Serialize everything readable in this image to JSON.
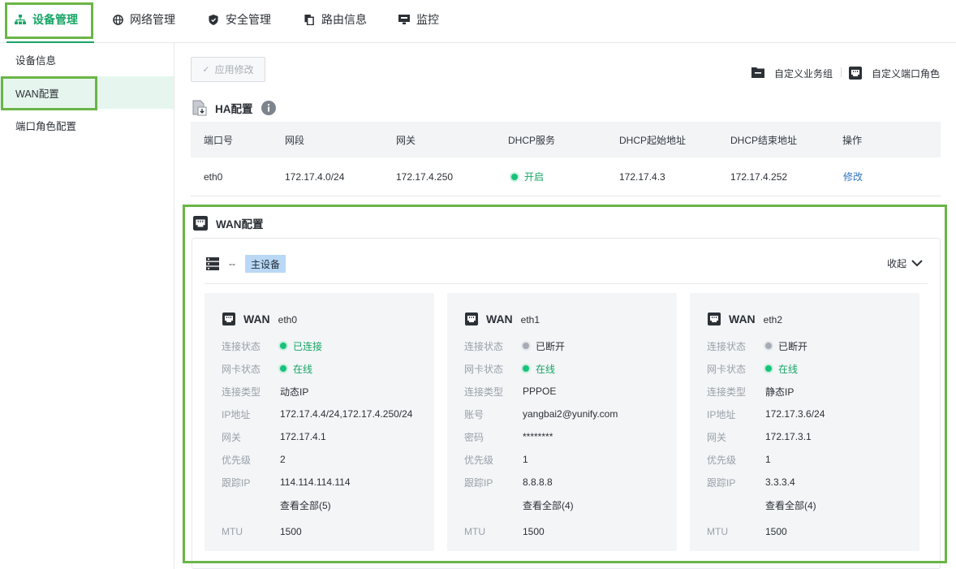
{
  "nav": {
    "tabs": [
      {
        "label": "设备管理",
        "icon": "network-device-icon"
      },
      {
        "label": "网络管理",
        "icon": "globe-icon"
      },
      {
        "label": "安全管理",
        "icon": "shield-icon"
      },
      {
        "label": "路由信息",
        "icon": "route-copy-icon"
      },
      {
        "label": "监控",
        "icon": "monitor-icon"
      }
    ]
  },
  "sidebar": {
    "items": [
      {
        "label": "设备信息"
      },
      {
        "label": "WAN配置"
      },
      {
        "label": "端口角色配置"
      }
    ]
  },
  "toolbar": {
    "apply_label": "应用修改",
    "custom_group_label": "自定义业务组",
    "custom_port_role_label": "自定义端口角色"
  },
  "ha": {
    "title": "HA配置",
    "columns": [
      "端口号",
      "网段",
      "网关",
      "DHCP服务",
      "DHCP起始地址",
      "DHCP结束地址",
      "操作"
    ],
    "row": {
      "port": "eth0",
      "segment": "172.17.4.0/24",
      "gateway": "172.17.4.250",
      "dhcp": "开启",
      "dhcp_start": "172.17.4.3",
      "dhcp_end": "172.17.4.252",
      "action": "修改"
    }
  },
  "wan": {
    "title": "WAN配置",
    "dash": "--",
    "device_badge": "主设备",
    "collapse_label": "收起",
    "cards": [
      {
        "wan": "WAN",
        "eth": "eth0",
        "rows": [
          {
            "k": "连接状态",
            "v": "已连接",
            "status": "green"
          },
          {
            "k": "网卡状态",
            "v": "在线",
            "status": "green"
          },
          {
            "k": "连接类型",
            "v": "动态IP"
          },
          {
            "k": "IP地址",
            "v": "172.17.4.4/24,172.17.4.250/24"
          },
          {
            "k": "网关",
            "v": "172.17.4.1"
          },
          {
            "k": "优先级",
            "v": "2"
          },
          {
            "k": "跟踪IP",
            "v": "114.114.114.114"
          }
        ],
        "more": "查看全部(5)",
        "mtu_k": "MTU",
        "mtu_v": "1500"
      },
      {
        "wan": "WAN",
        "eth": "eth1",
        "rows": [
          {
            "k": "连接状态",
            "v": "已断开",
            "status": "grey"
          },
          {
            "k": "网卡状态",
            "v": "在线",
            "status": "green"
          },
          {
            "k": "连接类型",
            "v": "PPPOE"
          },
          {
            "k": "账号",
            "v": "yangbai2@yunify.com"
          },
          {
            "k": "密码",
            "v": "********"
          },
          {
            "k": "优先级",
            "v": "1"
          },
          {
            "k": "跟踪IP",
            "v": "8.8.8.8"
          }
        ],
        "more": "查看全部(4)",
        "mtu_k": "MTU",
        "mtu_v": "1500"
      },
      {
        "wan": "WAN",
        "eth": "eth2",
        "rows": [
          {
            "k": "连接状态",
            "v": "已断开",
            "status": "grey"
          },
          {
            "k": "网卡状态",
            "v": "在线",
            "status": "green"
          },
          {
            "k": "连接类型",
            "v": "静态IP"
          },
          {
            "k": "IP地址",
            "v": "172.17.3.6/24"
          },
          {
            "k": "网关",
            "v": "172.17.3.1"
          },
          {
            "k": "优先级",
            "v": "1"
          },
          {
            "k": "跟踪IP",
            "v": "3.3.3.4"
          }
        ],
        "more": "查看全部(4)",
        "mtu_k": "MTU",
        "mtu_v": "1500"
      }
    ]
  },
  "colors": {
    "accent": "#17a565",
    "highlight_box": "#6ab547",
    "link": "#2f74c0"
  }
}
